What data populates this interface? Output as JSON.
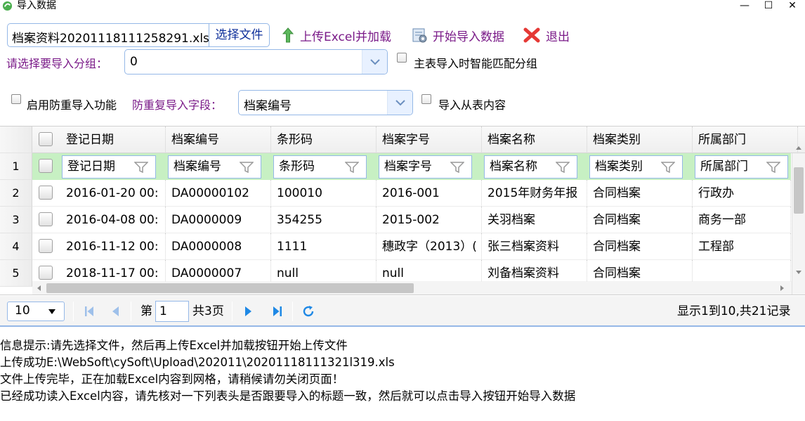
{
  "window": {
    "title": "导入数据",
    "min_glyph": "—",
    "max_glyph": "☐",
    "close_glyph": "✕"
  },
  "toolbar": {
    "file_name": "档案资料20201118111258291.xls",
    "choose_label": "选择文件",
    "upload_label": "上传Excel并加载",
    "import_label": "开始导入数据",
    "exit_label": "退出"
  },
  "group": {
    "label": "请选择要导入分组：",
    "value": "0",
    "smart_match_label": "主表导入时智能匹配分组"
  },
  "dedupe": {
    "enable_label": "启用防重导入功能",
    "field_label": "防重复导入字段：",
    "field_value": "档案编号",
    "import_sub_label": "导入从表内容"
  },
  "grid": {
    "columns": [
      "登记日期",
      "档案编号",
      "条形码",
      "档案字号",
      "档案名称",
      "档案类别",
      "所属部门"
    ],
    "filter_row_num": "1",
    "rows": [
      {
        "num": "2",
        "cells": [
          "2016-01-20 00:",
          "DA00000102",
          "100010",
          "2016-001",
          "2015年财务年报",
          "合同档案",
          "行政办"
        ]
      },
      {
        "num": "3",
        "cells": [
          "2016-04-08 00:",
          "DA0000009",
          "354255",
          "2015-002",
          "关羽档案",
          "合同档案",
          "商务一部"
        ]
      },
      {
        "num": "4",
        "cells": [
          "2016-11-12 00:",
          "DA0000008",
          "1111",
          "穗政字（2013）(",
          "张三档案资料",
          "合同档案",
          "工程部"
        ]
      },
      {
        "num": "5",
        "cells": [
          "2018-11-17 00:",
          "DA0000007",
          "null",
          "null",
          "刘备档案资料",
          "合同档案",
          ""
        ]
      }
    ]
  },
  "pager": {
    "page_size": "10",
    "page_prefix": "第",
    "page_value": "1",
    "page_total": "共3页",
    "summary": "显示1到10,共21记录"
  },
  "messages": [
    "信息提示:请先选择文件，然后再上传Excel并加载按钮开始上传文件",
    "上传成功E:\\WebSoft\\cySoft\\Upload\\202011\\20201118111321l319.xls",
    "文件上传完毕，正在加载Excel内容到网格，请稍候请勿关闭页面！",
    "已经成功读入Excel内容，请先核对一下列表头是否跟要导入的标题一致，然后就可以点击导入按钮开始导入数据"
  ],
  "colors": {
    "accent_blue": "#95b8e7",
    "label_purple": "#7a1a88",
    "filter_row_green": "#c7f0c3"
  },
  "icons": [
    "app-icon",
    "upload-arrow-icon",
    "import-icon",
    "exit-x-icon",
    "dropdown-arrow-icon",
    "filter-icon",
    "first-page-icon",
    "prev-page-icon",
    "next-page-icon",
    "last-page-icon",
    "refresh-icon"
  ]
}
